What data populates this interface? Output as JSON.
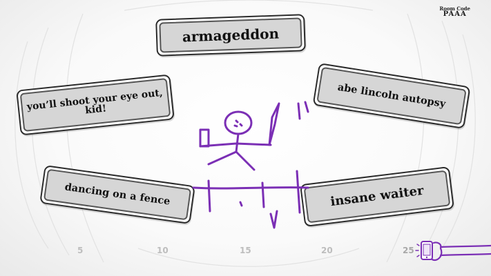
{
  "room": {
    "label": "Room Code",
    "code": "PAAA"
  },
  "cards": [
    {
      "text": "armageddon"
    },
    {
      "text": "you’ll shoot your eye out, kid!"
    },
    {
      "text": "abe lincoln autopsy"
    },
    {
      "text": "dancing on a fence"
    },
    {
      "text": "insane waiter"
    }
  ],
  "timer": {
    "ticks": [
      "5",
      "10",
      "15",
      "20",
      "25"
    ],
    "pointer_icon": "phone-icon"
  },
  "colors": {
    "drawing_stroke": "#7b2fb5",
    "pointer": "#7b2fb5",
    "card_fill": "#d6d6d6",
    "card_border": "#2b2b2b"
  }
}
